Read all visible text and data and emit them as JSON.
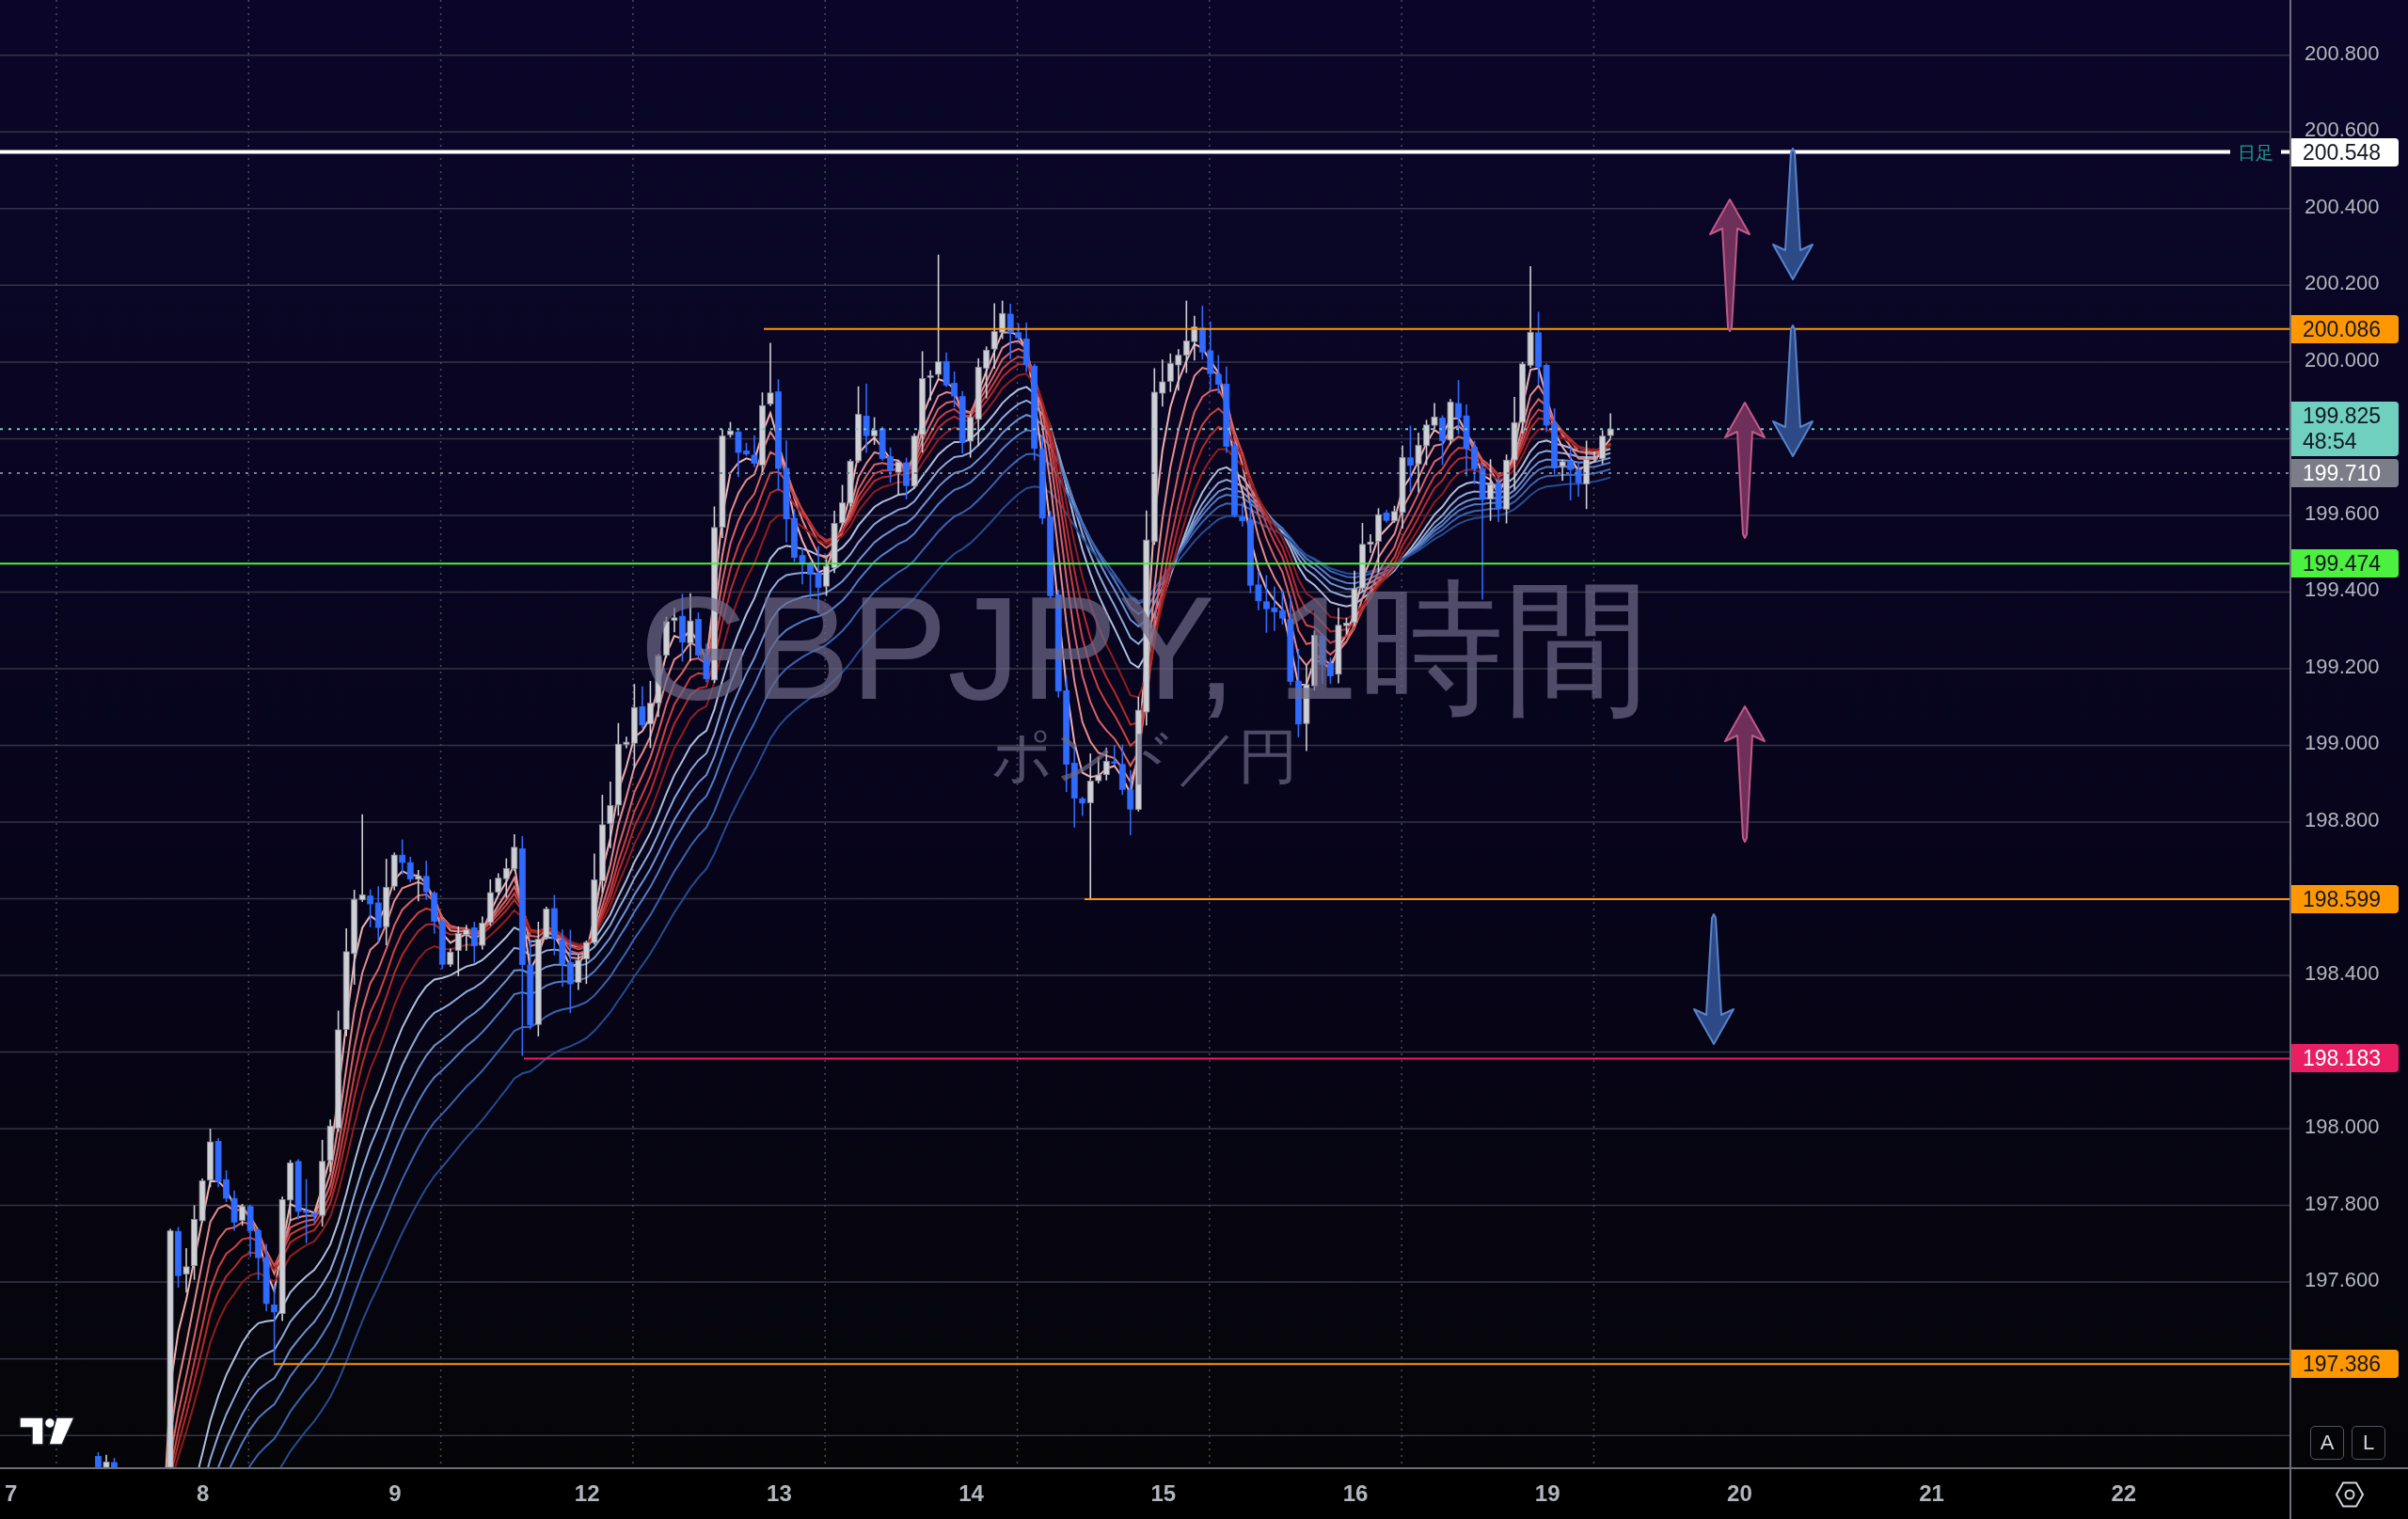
{
  "chart": {
    "symbol": "GBPJPY, 1時間",
    "description": "ポンド／円"
  },
  "price_levels": [
    {
      "price": "200.548",
      "color": "#ffffff",
      "kind": "bold",
      "note": "日足"
    },
    {
      "price": "200.086",
      "color": "#ff9800",
      "kind": "solid"
    },
    {
      "price": "199.825",
      "countdown": "48:54",
      "color": "#6fd0c0",
      "kind": "dotted"
    },
    {
      "price": "199.710",
      "color": "#7b7e89",
      "kind": "dotted"
    },
    {
      "price": "199.474",
      "color": "#4cf03e",
      "kind": "solid"
    },
    {
      "price": "198.599",
      "color": "#ff9800",
      "kind": "solid"
    },
    {
      "price": "198.183",
      "color": "#e91e63",
      "kind": "solid"
    },
    {
      "price": "197.386",
      "color": "#ff9800",
      "kind": "solid"
    }
  ],
  "price_axis": {
    "ticks": [
      "200.800",
      "200.600",
      "200.400",
      "200.200",
      "200.000",
      "199.600",
      "199.400",
      "199.200",
      "199.000",
      "198.800",
      "198.400",
      "198.000",
      "197.800",
      "197.600"
    ]
  },
  "time_axis": {
    "labels": [
      "7",
      "8",
      "9",
      "12",
      "13",
      "14",
      "15",
      "16",
      "19",
      "20",
      "21",
      "22"
    ]
  },
  "scale_buttons": [
    {
      "label": "A",
      "on": false
    },
    {
      "label": "L",
      "on": false
    }
  ]
}
